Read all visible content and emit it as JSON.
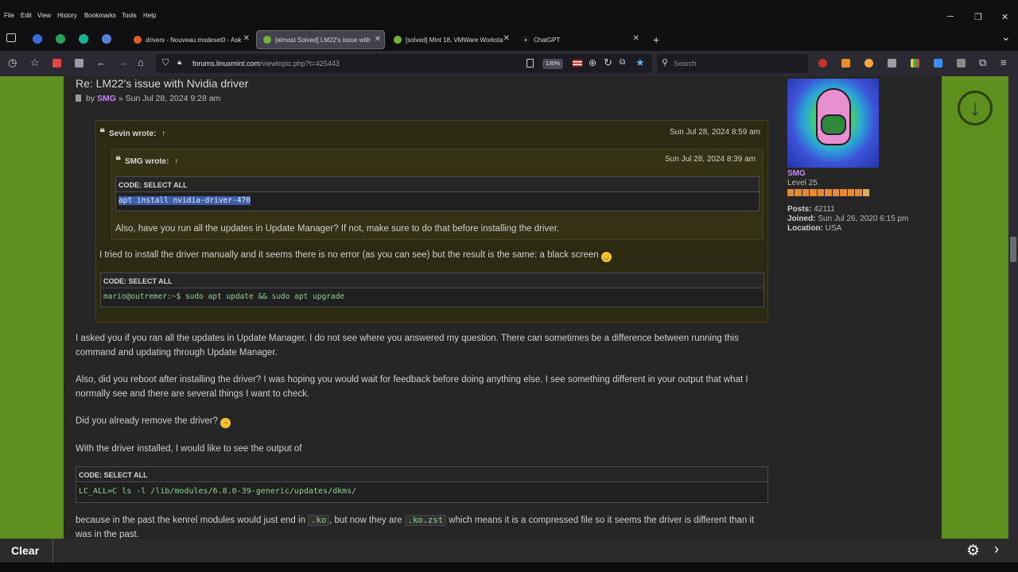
{
  "menubar": {
    "items": [
      "File",
      "Edit",
      "View",
      "History",
      "Bookmarks",
      "Tools",
      "Help"
    ]
  },
  "window_controls": {
    "minimize": "─",
    "restore": "❐",
    "close": "✕"
  },
  "tabs": [
    {
      "title": "drivers - Nouveau.modeset0 - Ask",
      "favicon_color": "#e55a2b",
      "active": false
    },
    {
      "title": "[almost Solved] LM22's issue with",
      "favicon_color": "#6fb33b",
      "active": true
    },
    {
      "title": "[solved] Mint 18, VMWare Worksta",
      "favicon_color": "#6fb33b",
      "active": false
    },
    {
      "title": "ChatGPT",
      "favicon_color": "#1c1b22",
      "active": false
    }
  ],
  "tab_close": "✕",
  "new_tab": "+",
  "tab_list": "⌄",
  "address": {
    "domain": "forums.linuxmint.com",
    "path": "/viewtopic.php?t=425443",
    "zoom": "130%"
  },
  "search": {
    "placeholder": "Search"
  },
  "post": {
    "title": "Re: LM22's issue with Nvidia driver",
    "by": "by",
    "author": "SMG",
    "date": "» Sun Jul 28, 2024 9:28 am",
    "outer_quote": {
      "author": "Sevin wrote:",
      "arrow": "↑",
      "date": "Sun Jul 28, 2024 8:59 am",
      "inner_quote": {
        "author": "SMG wrote:",
        "arrow": "↑",
        "date": "Sun Jul 28, 2024 8:39 am",
        "code_header": "CODE: SELECT ALL",
        "code": "apt install nvidia-driver-470",
        "text": "Also, have you run all the updates in Update Manager? If not, make sure to do that before installing the driver."
      },
      "text": "I tried to install the driver manually and it seems there is no error (as you can see) but the result is the same: a black screen",
      "code_header": "CODE: SELECT ALL",
      "code": "mario@outremer:~$ sudo apt update && sudo apt upgrade"
    },
    "paragraphs": [
      "I asked you if you ran all the updates in Update Manager. I do not see where you answered my question. There can sometimes be a difference between running this command and updating through Update Manager.",
      "Also, did you reboot after installing the driver? I was hoping you would wait for feedback before doing anything else. I see something different in your output that what I normally see and there are several things I want to check.",
      "Did you already remove the driver?",
      "With the driver installed, I would like to see the output of"
    ],
    "code_header": "CODE: SELECT ALL",
    "code": "LC_ALL=C ls -l /lib/modules/6.8.0-39-generic/updates/dkms/",
    "closing": {
      "before": "because in the past the kenrel modules would just end in",
      "code1": ".ko",
      "middle": ", but now they are",
      "code2": ".ko.zst",
      "after": "which means it is a compressed file so it seems the driver is different than it was in the past."
    }
  },
  "profile": {
    "name": "SMG",
    "rank": "Level 25",
    "posts_label": "Posts:",
    "posts": "42111",
    "joined_label": "Joined:",
    "joined": "Sun Jul 26, 2020 6:15 pm",
    "location_label": "Location:",
    "location": "USA"
  },
  "bottombar": {
    "clear": "Clear"
  },
  "colors": {
    "accent_green": "#5e8e1e",
    "author_purple": "#c687f0",
    "code_green": "#8fd18f"
  }
}
